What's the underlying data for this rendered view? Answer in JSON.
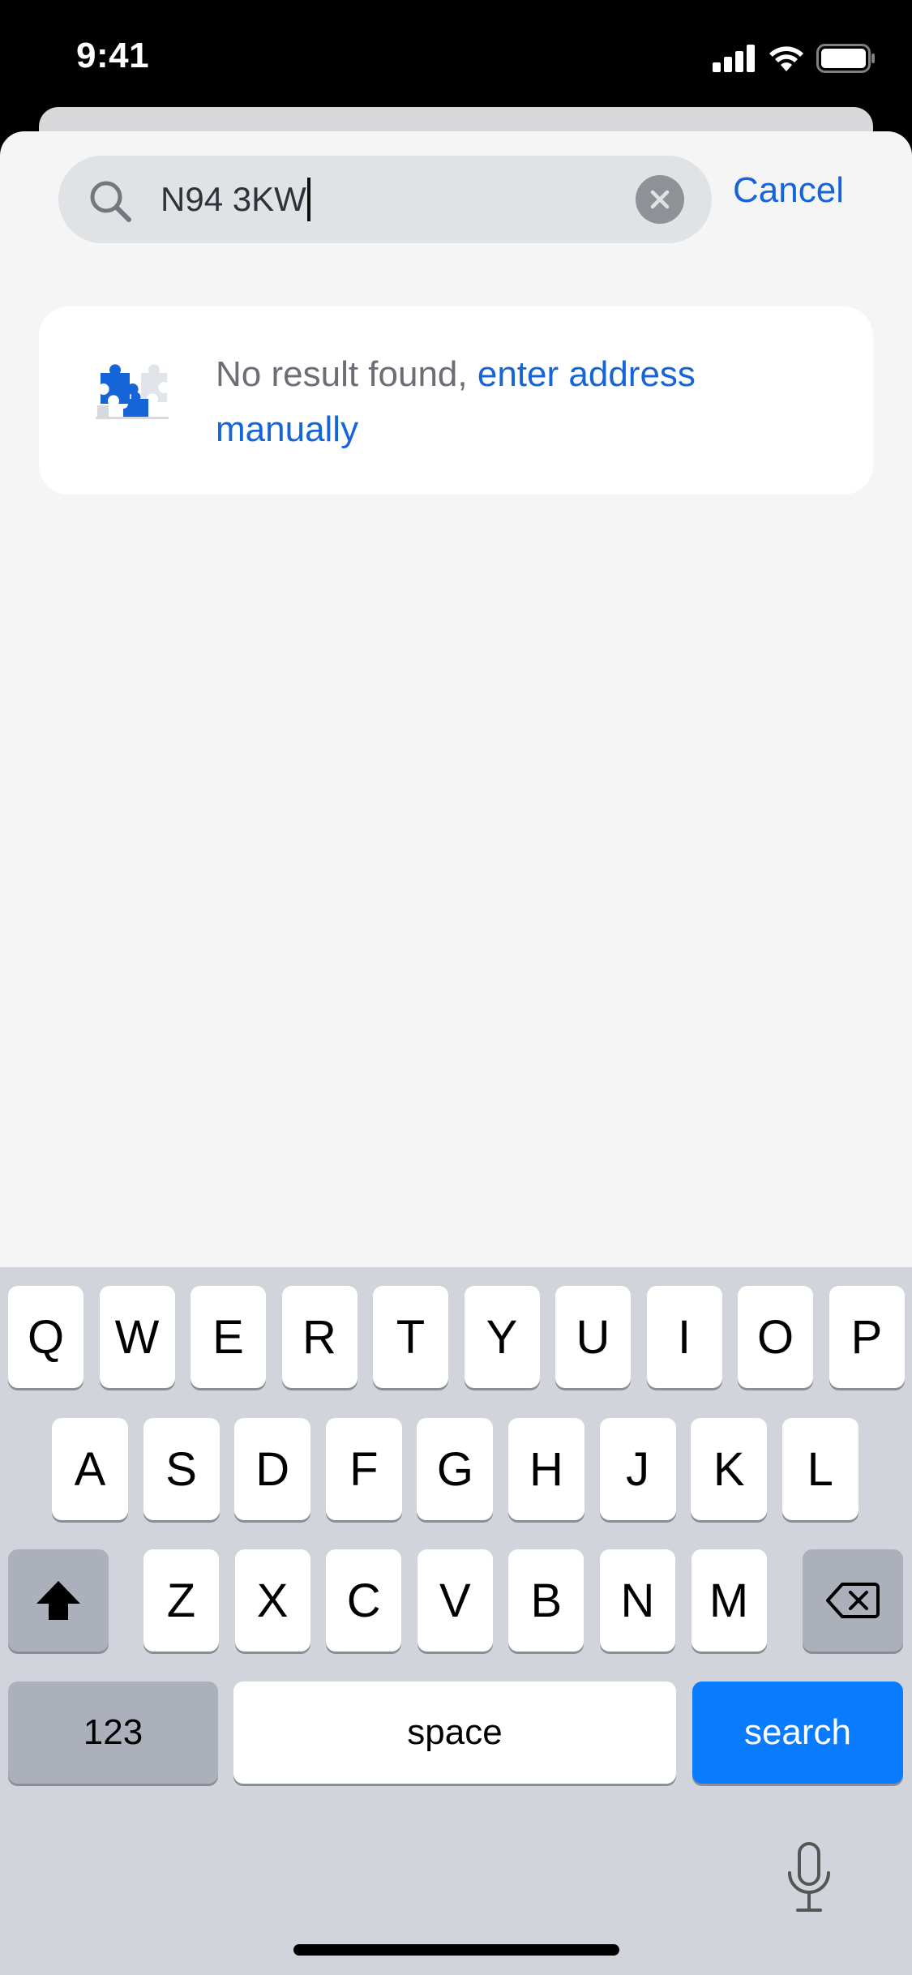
{
  "status_bar": {
    "time": "9:41"
  },
  "search": {
    "query": "N94 3KW",
    "cancel_label": "Cancel"
  },
  "result": {
    "message": "No result found, ",
    "link": "enter address manually"
  },
  "keyboard": {
    "row1": [
      "Q",
      "W",
      "E",
      "R",
      "T",
      "Y",
      "U",
      "I",
      "O",
      "P"
    ],
    "row2": [
      "A",
      "S",
      "D",
      "F",
      "G",
      "H",
      "J",
      "K",
      "L"
    ],
    "row3": [
      "Z",
      "X",
      "C",
      "V",
      "B",
      "N",
      "M"
    ],
    "numbers_label": "123",
    "space_label": "space",
    "search_label": "search"
  },
  "colors": {
    "accent": "#1565d8",
    "search_key": "#0a7aff",
    "sheet_bg": "#f5f5f5",
    "keyboard_bg": "#d1d4da"
  }
}
